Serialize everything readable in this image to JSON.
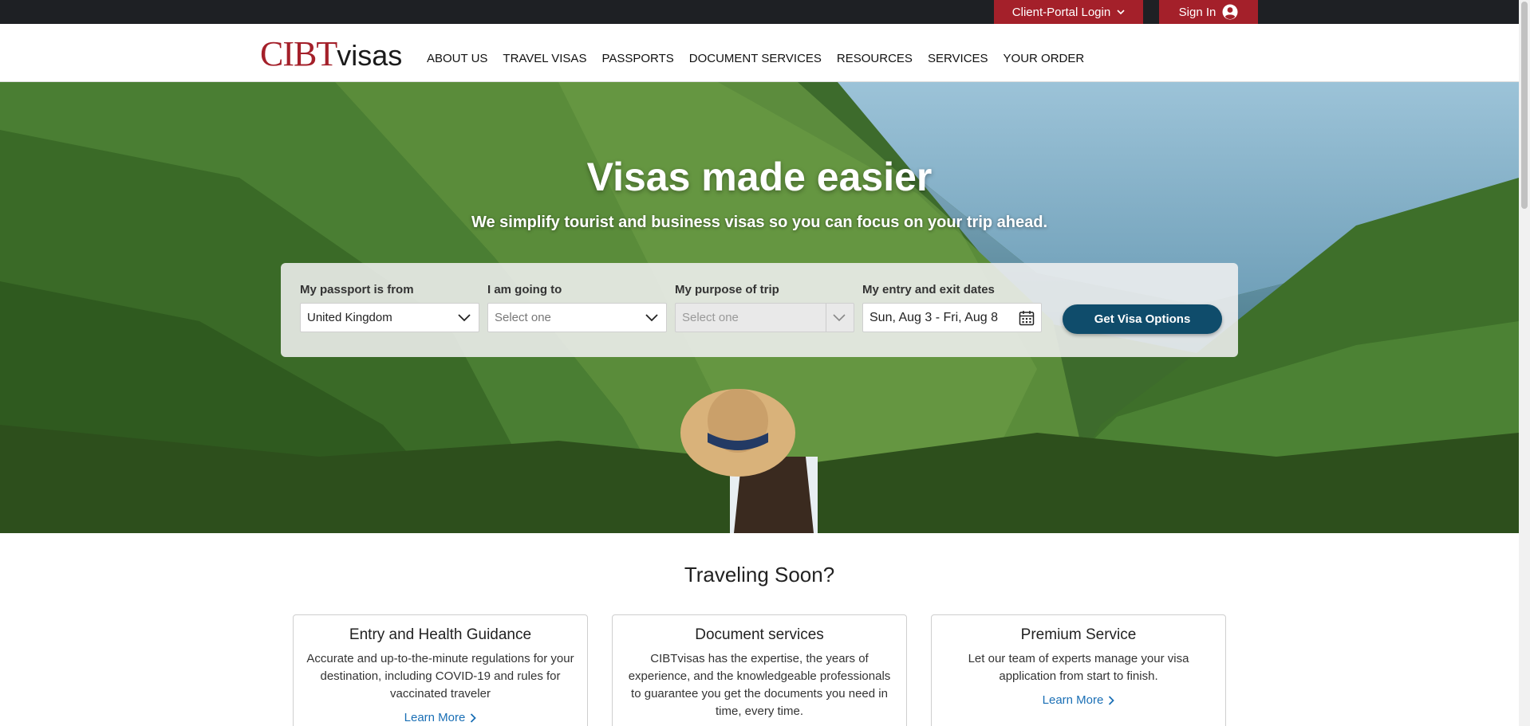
{
  "topbar": {
    "client_portal_label": "Client-Portal Login",
    "sign_in_label": "Sign In"
  },
  "header": {
    "logo_cibt": "CIBT",
    "logo_visas": "visas",
    "nav": [
      {
        "label": "ABOUT US"
      },
      {
        "label": "TRAVEL VISAS"
      },
      {
        "label": "PASSPORTS"
      },
      {
        "label": "DOCUMENT SERVICES"
      },
      {
        "label": "RESOURCES"
      },
      {
        "label": "SERVICES"
      },
      {
        "label": "YOUR ORDER"
      }
    ]
  },
  "hero": {
    "title": "Visas made easier",
    "subtitle": "We simplify tourist and business visas so you can focus on your trip ahead."
  },
  "form": {
    "passport_label": "My passport is from",
    "passport_value": "United Kingdom",
    "destination_label": "I am going to",
    "destination_value": "Select one",
    "purpose_label": "My purpose of trip",
    "purpose_value": "Select one",
    "dates_label": "My entry and exit dates",
    "dates_value": "Sun, Aug 3 - Fri, Aug 8",
    "submit_label": "Get Visa Options"
  },
  "traveling_soon": {
    "title": "Traveling Soon?",
    "cards": [
      {
        "title": "Entry and Health Guidance",
        "text": "Accurate and up-to-the-minute regulations for your destination, including COVID-19 and rules for vaccinated traveler",
        "link": "Learn More"
      },
      {
        "title": "Document services",
        "text": "CIBTvisas has the expertise, the years of experience, and the knowledgeable professionals to guarantee you get the documents you need in time, every time.",
        "link": ""
      },
      {
        "title": "Premium Service",
        "text": "Let our team of experts manage your visa application from start to finish.",
        "link": "Learn More"
      }
    ]
  },
  "colors": {
    "brand_red": "#a4202a",
    "topbar_dark": "#1e2024",
    "button_blue": "#0f4c6b",
    "link_blue": "#1a6fb5"
  },
  "icons": {
    "portal_chevron": "chevron-down-icon",
    "sign_in": "user-circle-icon",
    "select_chevron": "chevron-down-icon",
    "calendar": "calendar-icon",
    "link_arrow": "chevron-right-icon"
  }
}
